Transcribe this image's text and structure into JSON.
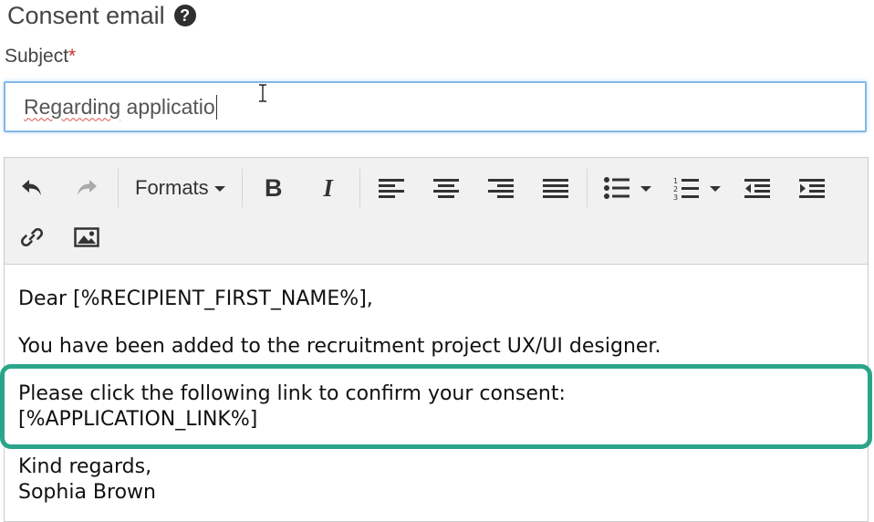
{
  "section": {
    "title": "Consent email",
    "help_icon": "question-circle-icon"
  },
  "subject": {
    "label": "Subject",
    "required_marker": "*",
    "value_misspelled": "Regarding",
    "value_rest": " applicatio"
  },
  "toolbar": {
    "undo_icon": "undo-icon",
    "redo_icon": "redo-icon",
    "formats_label": "Formats",
    "bold_label": "B",
    "italic_label": "I",
    "align_left_icon": "align-left-icon",
    "align_center_icon": "align-center-icon",
    "align_right_icon": "align-right-icon",
    "align_justify_icon": "align-justify-icon",
    "bullet_list_icon": "bullet-list-icon",
    "numbered_list_icon": "numbered-list-icon",
    "outdent_icon": "outdent-icon",
    "indent_icon": "indent-icon",
    "link_icon": "link-icon",
    "image_icon": "image-icon"
  },
  "body": {
    "greeting": "Dear [%RECIPIENT_FIRST_NAME%],",
    "intro": "You have been added to the recruitment project UX/UI designer.",
    "link_line_1": "Please click the following link to confirm your consent:",
    "link_line_2": "[%APPLICATION_LINK%]",
    "closing": "Kind regards,",
    "signature": "Sophia Brown"
  },
  "colors": {
    "highlight": "#2aa58a",
    "input_focus_border": "#84b8e6",
    "required": "#c9302c",
    "toolbar_bg": "#f1f1f1"
  }
}
